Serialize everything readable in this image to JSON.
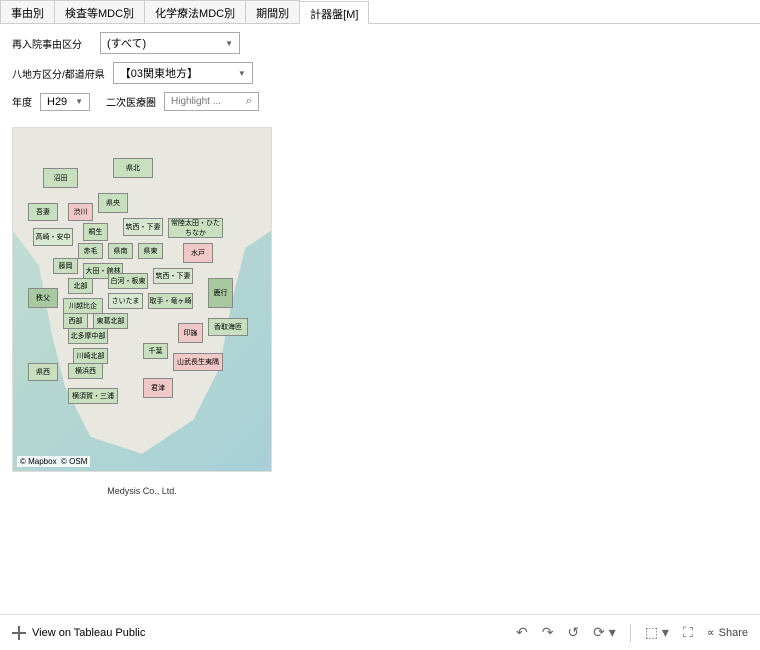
{
  "tabs": [
    {
      "label": "事由別"
    },
    {
      "label": "検査等MDC別"
    },
    {
      "label": "化学療法MDC別"
    },
    {
      "label": "期間別"
    },
    {
      "label": "計器盤[M]"
    }
  ],
  "active_tab": 4,
  "filters": {
    "readmission_label": "再入院事由区分",
    "readmission_value": "(すべて)",
    "region_label": "八地方区分/都道府県",
    "region_value": "【03関東地方】",
    "year_label": "年度",
    "year_value": "H29",
    "secondary_label": "二次医療圏",
    "search_placeholder": "Highlight ..."
  },
  "map": {
    "attribution_mapbox": "© Mapbox",
    "attribution_osm": "© OSM",
    "regions": [
      {
        "name": "沼田",
        "color": "green"
      },
      {
        "name": "県北",
        "color": "green"
      },
      {
        "name": "吾妻",
        "color": "green"
      },
      {
        "name": "渋川",
        "color": "pink"
      },
      {
        "name": "県央",
        "color": "green"
      },
      {
        "name": "桐生",
        "color": "green"
      },
      {
        "name": "筑西・下妻",
        "color": "lgreen"
      },
      {
        "name": "常陸太田・ひたちなか",
        "color": "green"
      },
      {
        "name": "高崎・安中",
        "color": "lgreen"
      },
      {
        "name": "赤毛",
        "color": "green"
      },
      {
        "name": "県南",
        "color": "green"
      },
      {
        "name": "県東",
        "color": "green"
      },
      {
        "name": "水戸",
        "color": "pink"
      },
      {
        "name": "藤岡",
        "color": "green"
      },
      {
        "name": "大田・館林",
        "color": "green"
      },
      {
        "name": "北部",
        "color": "green"
      },
      {
        "name": "白河・板東",
        "color": "green"
      },
      {
        "name": "筑西・下妻",
        "color": "lgreen"
      },
      {
        "name": "鹿行",
        "color": "dgreen"
      },
      {
        "name": "秩父",
        "color": "dgreen"
      },
      {
        "name": "川越比企",
        "color": "green"
      },
      {
        "name": "さいたま",
        "color": "lgreen"
      },
      {
        "name": "取手・竜ヶ崎",
        "color": "green"
      },
      {
        "name": "西部",
        "color": "green"
      },
      {
        "name": "東葛北部",
        "color": "green"
      },
      {
        "name": "印旛",
        "color": "pink"
      },
      {
        "name": "香取海匝",
        "color": "green"
      },
      {
        "name": "北多摩中部",
        "color": "green"
      },
      {
        "name": "川崎北部",
        "color": "green"
      },
      {
        "name": "千葉",
        "color": "green"
      },
      {
        "name": "山武長生夷隅",
        "color": "pink"
      },
      {
        "name": "横浜西",
        "color": "green"
      },
      {
        "name": "県西",
        "color": "green"
      },
      {
        "name": "君津",
        "color": "pink"
      },
      {
        "name": "横須賀・三浦",
        "color": "green"
      }
    ]
  },
  "footer": "Medysis Co., Ltd.",
  "toolbar": {
    "view_label": "View on Tableau Public",
    "share_label": "Share"
  }
}
